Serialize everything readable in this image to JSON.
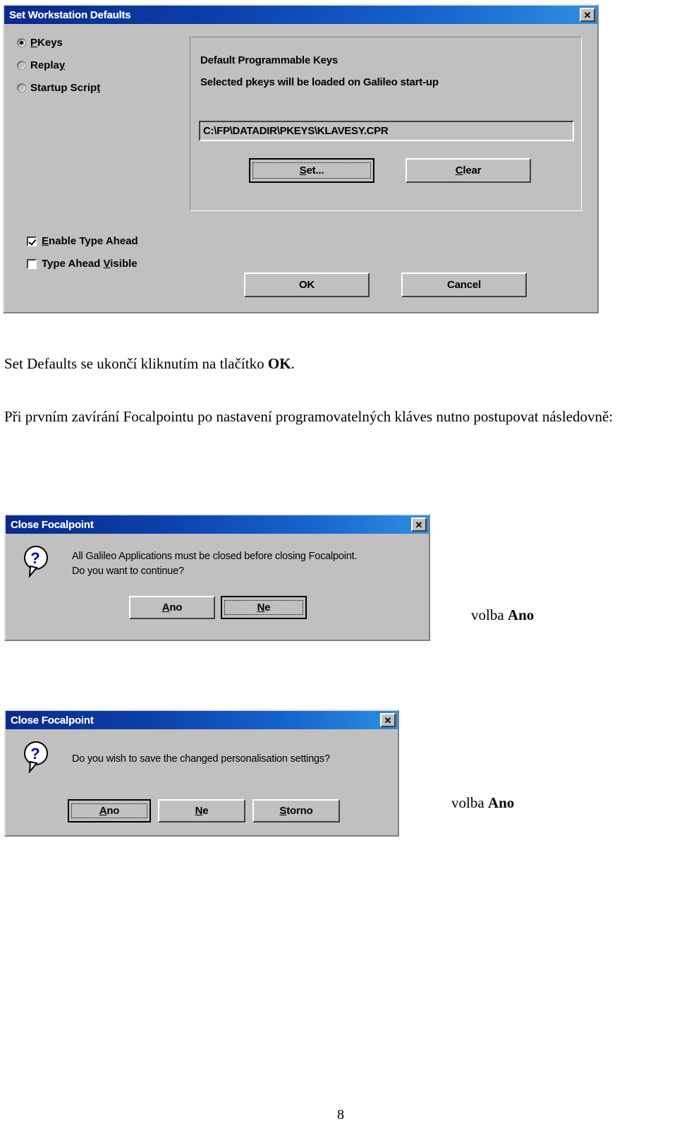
{
  "page": {
    "number": "8"
  },
  "dialog1": {
    "title": "Set Workstation Defaults",
    "close_label": "✕",
    "radios": [
      {
        "label_before": "",
        "mnemonic": "P",
        "label_after": "Keys",
        "selected": true
      },
      {
        "label_before": "Repla",
        "mnemonic": "y",
        "label_after": "",
        "selected": false
      },
      {
        "label_before": "Startup Scrip",
        "mnemonic": "t",
        "label_after": "",
        "selected": false
      }
    ],
    "group_heading": "Default Programmable Keys",
    "group_subheading": "Selected pkeys will be loaded on Galileo start-up",
    "path_value": "C:\\FP\\DATADIR\\PKEYS\\KLAVESY.CPR",
    "set_button": {
      "before": "",
      "mnemonic": "S",
      "after": "et..."
    },
    "clear_button": {
      "before": "",
      "mnemonic": "C",
      "after": "lear"
    },
    "checkboxes": [
      {
        "before": "",
        "mnemonic": "E",
        "after": "nable Type Ahead",
        "checked": true
      },
      {
        "before": "Type Ahead ",
        "mnemonic": "V",
        "after": "isible",
        "checked": false
      }
    ],
    "ok_button": "OK",
    "cancel_button": "Cancel"
  },
  "paragraph1": {
    "before_bold": "Set Defaults se ukončí kliknutím na tlačítko ",
    "bold": "OK",
    "after_bold": "."
  },
  "paragraph2": {
    "text": "Při prvním zavírání Focalpointu po nastavení programovatelných kláves nutno postupovat následovně:"
  },
  "dialog2": {
    "title": "Close Focalpoint",
    "close_label": "✕",
    "icon": "question-icon",
    "message": "All Galileo Applications must be closed before closing Focalpoint.\nDo you want to continue?",
    "buttons": [
      {
        "before": "",
        "mnemonic": "A",
        "after": "no",
        "focused": false
      },
      {
        "before": "",
        "mnemonic": "N",
        "after": "e",
        "focused": true
      }
    ]
  },
  "caption2": {
    "before_bold": "volba ",
    "bold": "Ano"
  },
  "dialog3": {
    "title": "Close Focalpoint",
    "close_label": "✕",
    "icon": "question-icon",
    "message": "Do you wish to save the changed personalisation settings?",
    "buttons": [
      {
        "before": "",
        "mnemonic": "A",
        "after": "no",
        "focused": true
      },
      {
        "before": "",
        "mnemonic": "N",
        "after": "e",
        "focused": false
      },
      {
        "before": "",
        "mnemonic": "S",
        "after": "torno",
        "focused": false
      }
    ]
  },
  "caption3": {
    "before_bold": "volba ",
    "bold": "Ano"
  },
  "colors": {
    "titlebar_start": "#0a2a8c",
    "titlebar_end": "#2f8ee0",
    "dialog_face": "#c0c0c0",
    "question_blue": "#0000c8"
  }
}
